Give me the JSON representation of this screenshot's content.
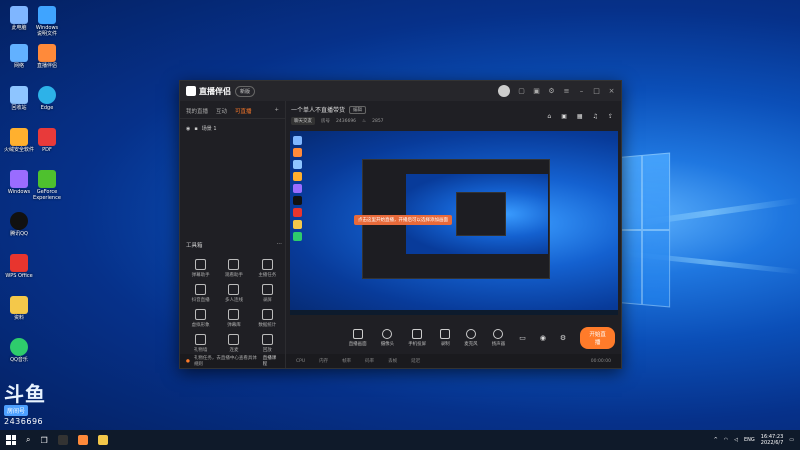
{
  "desktop": {
    "icons": [
      {
        "label": "此电脑",
        "color": "#7fb6ff"
      },
      {
        "label": "Windows\n说明文件",
        "color": "#3fa4ff"
      },
      {
        "label": "网络",
        "color": "#62b1ff"
      },
      {
        "label": "直播伴侣",
        "color": "#ff8a3a"
      },
      {
        "label": "回收站",
        "color": "#8ec5ff"
      },
      {
        "label": "Edge",
        "color": "#2db2e8"
      },
      {
        "label": "火绒安全软件",
        "color": "#ffb02e"
      },
      {
        "label": "PDF",
        "color": "#e83a3a"
      },
      {
        "label": "Windows",
        "color": "#9a6cff"
      },
      {
        "label": "GeForce\nExperience",
        "color": "#4ec12e"
      },
      {
        "label": "腾讯QQ",
        "color": "#111"
      },
      {
        "label": "WPS Office",
        "color": "#e8352e"
      },
      {
        "label": "资料",
        "color": "#f4c84a"
      },
      {
        "label": "QQ音乐",
        "color": "#2ecc6c"
      }
    ]
  },
  "app": {
    "name": "直播伴侣",
    "version": "新版",
    "tabs": [
      "我的直播",
      "互动",
      "可直播"
    ],
    "active_tab": 2,
    "scene_label": "场景 1",
    "tools_title": "工具箱",
    "tools": [
      {
        "label": "弹幕助手"
      },
      {
        "label": "观看助手"
      },
      {
        "label": "主播任务"
      },
      {
        "label": "抖音直播"
      },
      {
        "label": "多人连线"
      },
      {
        "label": "录屏"
      },
      {
        "label": "虚拟形象"
      },
      {
        "label": "弹幕库"
      },
      {
        "label": "数据统计"
      },
      {
        "label": "礼物墙"
      },
      {
        "label": "连麦"
      },
      {
        "label": "回放"
      }
    ],
    "status_message": "礼物任务，去直播中心查看具体规则",
    "status_link": "直播课程",
    "room": {
      "title": "一个单人不直播带货",
      "edit_label": "编辑",
      "category": "聊天交友",
      "id_label": "房号",
      "id_value": "2436696",
      "fans_value": "2857"
    },
    "callout_text": "点击这里开始直播，开播后可以选择添加画面",
    "controls": [
      {
        "label": "直播画面"
      },
      {
        "label": "摄像头"
      },
      {
        "label": "手机投屏"
      },
      {
        "label": "录制"
      },
      {
        "label": "麦克风"
      },
      {
        "label": "扬声器"
      }
    ],
    "start_button": "开始直播",
    "stats": [
      "CPU",
      "内存",
      "帧率",
      "码率",
      "丢帧",
      "延迟"
    ],
    "elapsed": "00:00:00"
  },
  "watermark": {
    "big": "斗鱼",
    "pill": "房间号",
    "room_number": "2436696"
  },
  "taskbar": {
    "lang": "ENG",
    "time": "16:47:23",
    "date": "2022/6/7"
  }
}
